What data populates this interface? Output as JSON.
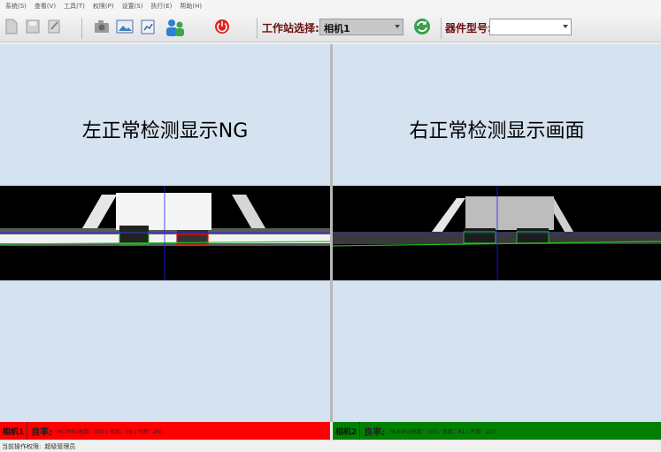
{
  "menu": [
    "系统(S)",
    "查看(V)",
    "工具(T)",
    "权限(P)",
    "设置(S)",
    "执行(E)",
    "帮助(H)"
  ],
  "toolbar": {
    "station_label": "工作站选择:",
    "station_value": "相机1",
    "device_label": "器件型号:",
    "device_value": "",
    "icons": [
      "new-file-icon",
      "save-icon",
      "edit-icon",
      "camera-icon",
      "image-icon",
      "report-icon",
      "users-icon",
      "power-icon",
      "refresh-icon"
    ]
  },
  "left_panel": {
    "title": "左正常检测显示NG",
    "status": {
      "camera": "相机1",
      "yield_label": "良率:",
      "stats": "76.70%(总数：103 / 良品：79 / 不良：24)",
      "color": "#ff0000"
    }
  },
  "right_panel": {
    "title": "右正常检测显示画面",
    "status": {
      "camera": "相机2",
      "yield_label": "良率:",
      "stats": "78.64%(总数：103 / 良品：81 / 不良：22)",
      "color": "#008000"
    }
  },
  "footer": {
    "permission_label": "当前操作权限:",
    "permission_value": "超级管理员"
  },
  "colors": {
    "panel_bg": "#d5e2ef",
    "ng": "#ff0000",
    "ok": "#008000",
    "title_text": "#6b0f0f"
  }
}
